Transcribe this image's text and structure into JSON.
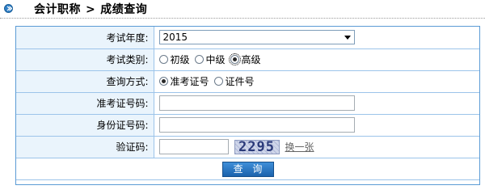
{
  "header": {
    "title_part1": "会计职称",
    "separator": ">",
    "title_part2": "成绩查询"
  },
  "form": {
    "exam_year": {
      "label": "考试年度:",
      "selected": "2015"
    },
    "exam_category": {
      "label": "考试类别:",
      "options": [
        {
          "label": "初级",
          "checked": false
        },
        {
          "label": "中级",
          "checked": false
        },
        {
          "label": "高级",
          "checked": true
        }
      ]
    },
    "query_method": {
      "label": "查询方式:",
      "options": [
        {
          "label": "准考证号",
          "checked": true
        },
        {
          "label": "证件号",
          "checked": false
        }
      ]
    },
    "admission_no": {
      "label": "准考证号码:",
      "value": ""
    },
    "id_no": {
      "label": "身份证号码:",
      "value": ""
    },
    "captcha": {
      "label": "验证码:",
      "value": "",
      "image_text": "2295",
      "refresh_label": "换一张"
    },
    "submit_label": "查 询"
  },
  "colors": {
    "border": "#5b9bd5",
    "label_bg": "#eaf4fc",
    "button": "#1b62ad"
  }
}
